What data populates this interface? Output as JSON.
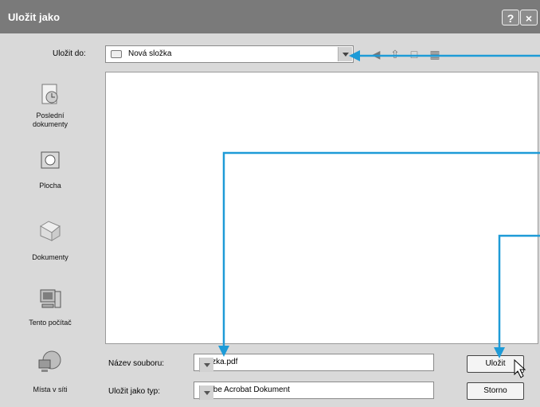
{
  "dialog": {
    "title": "Uložit jako",
    "help_glyph": "?",
    "close_glyph": "×"
  },
  "save_in": {
    "label": "Uložit do:",
    "value": "Nová složka"
  },
  "places": [
    {
      "label_line1": "Poslední",
      "label_line2": "dokumenty",
      "icon": "recent-documents-icon"
    },
    {
      "label_line1": "Plocha",
      "label_line2": "",
      "icon": "desktop-icon"
    },
    {
      "label_line1": "Dokumenty",
      "label_line2": "",
      "icon": "documents-icon"
    },
    {
      "label_line1": "Tento počítač",
      "label_line2": "",
      "icon": "computer-icon"
    },
    {
      "label_line1": "Místa v síti",
      "label_line2": "",
      "icon": "network-icon"
    }
  ],
  "filename": {
    "label": "Název souboru:",
    "value": "ukazka.pdf"
  },
  "filetype": {
    "label": "Uložit jako typ:",
    "value": "Adobe Acrobat Dokument"
  },
  "buttons": {
    "save": "Uložit",
    "cancel": "Storno"
  },
  "colors": {
    "annotation": "#1e9bd7"
  }
}
